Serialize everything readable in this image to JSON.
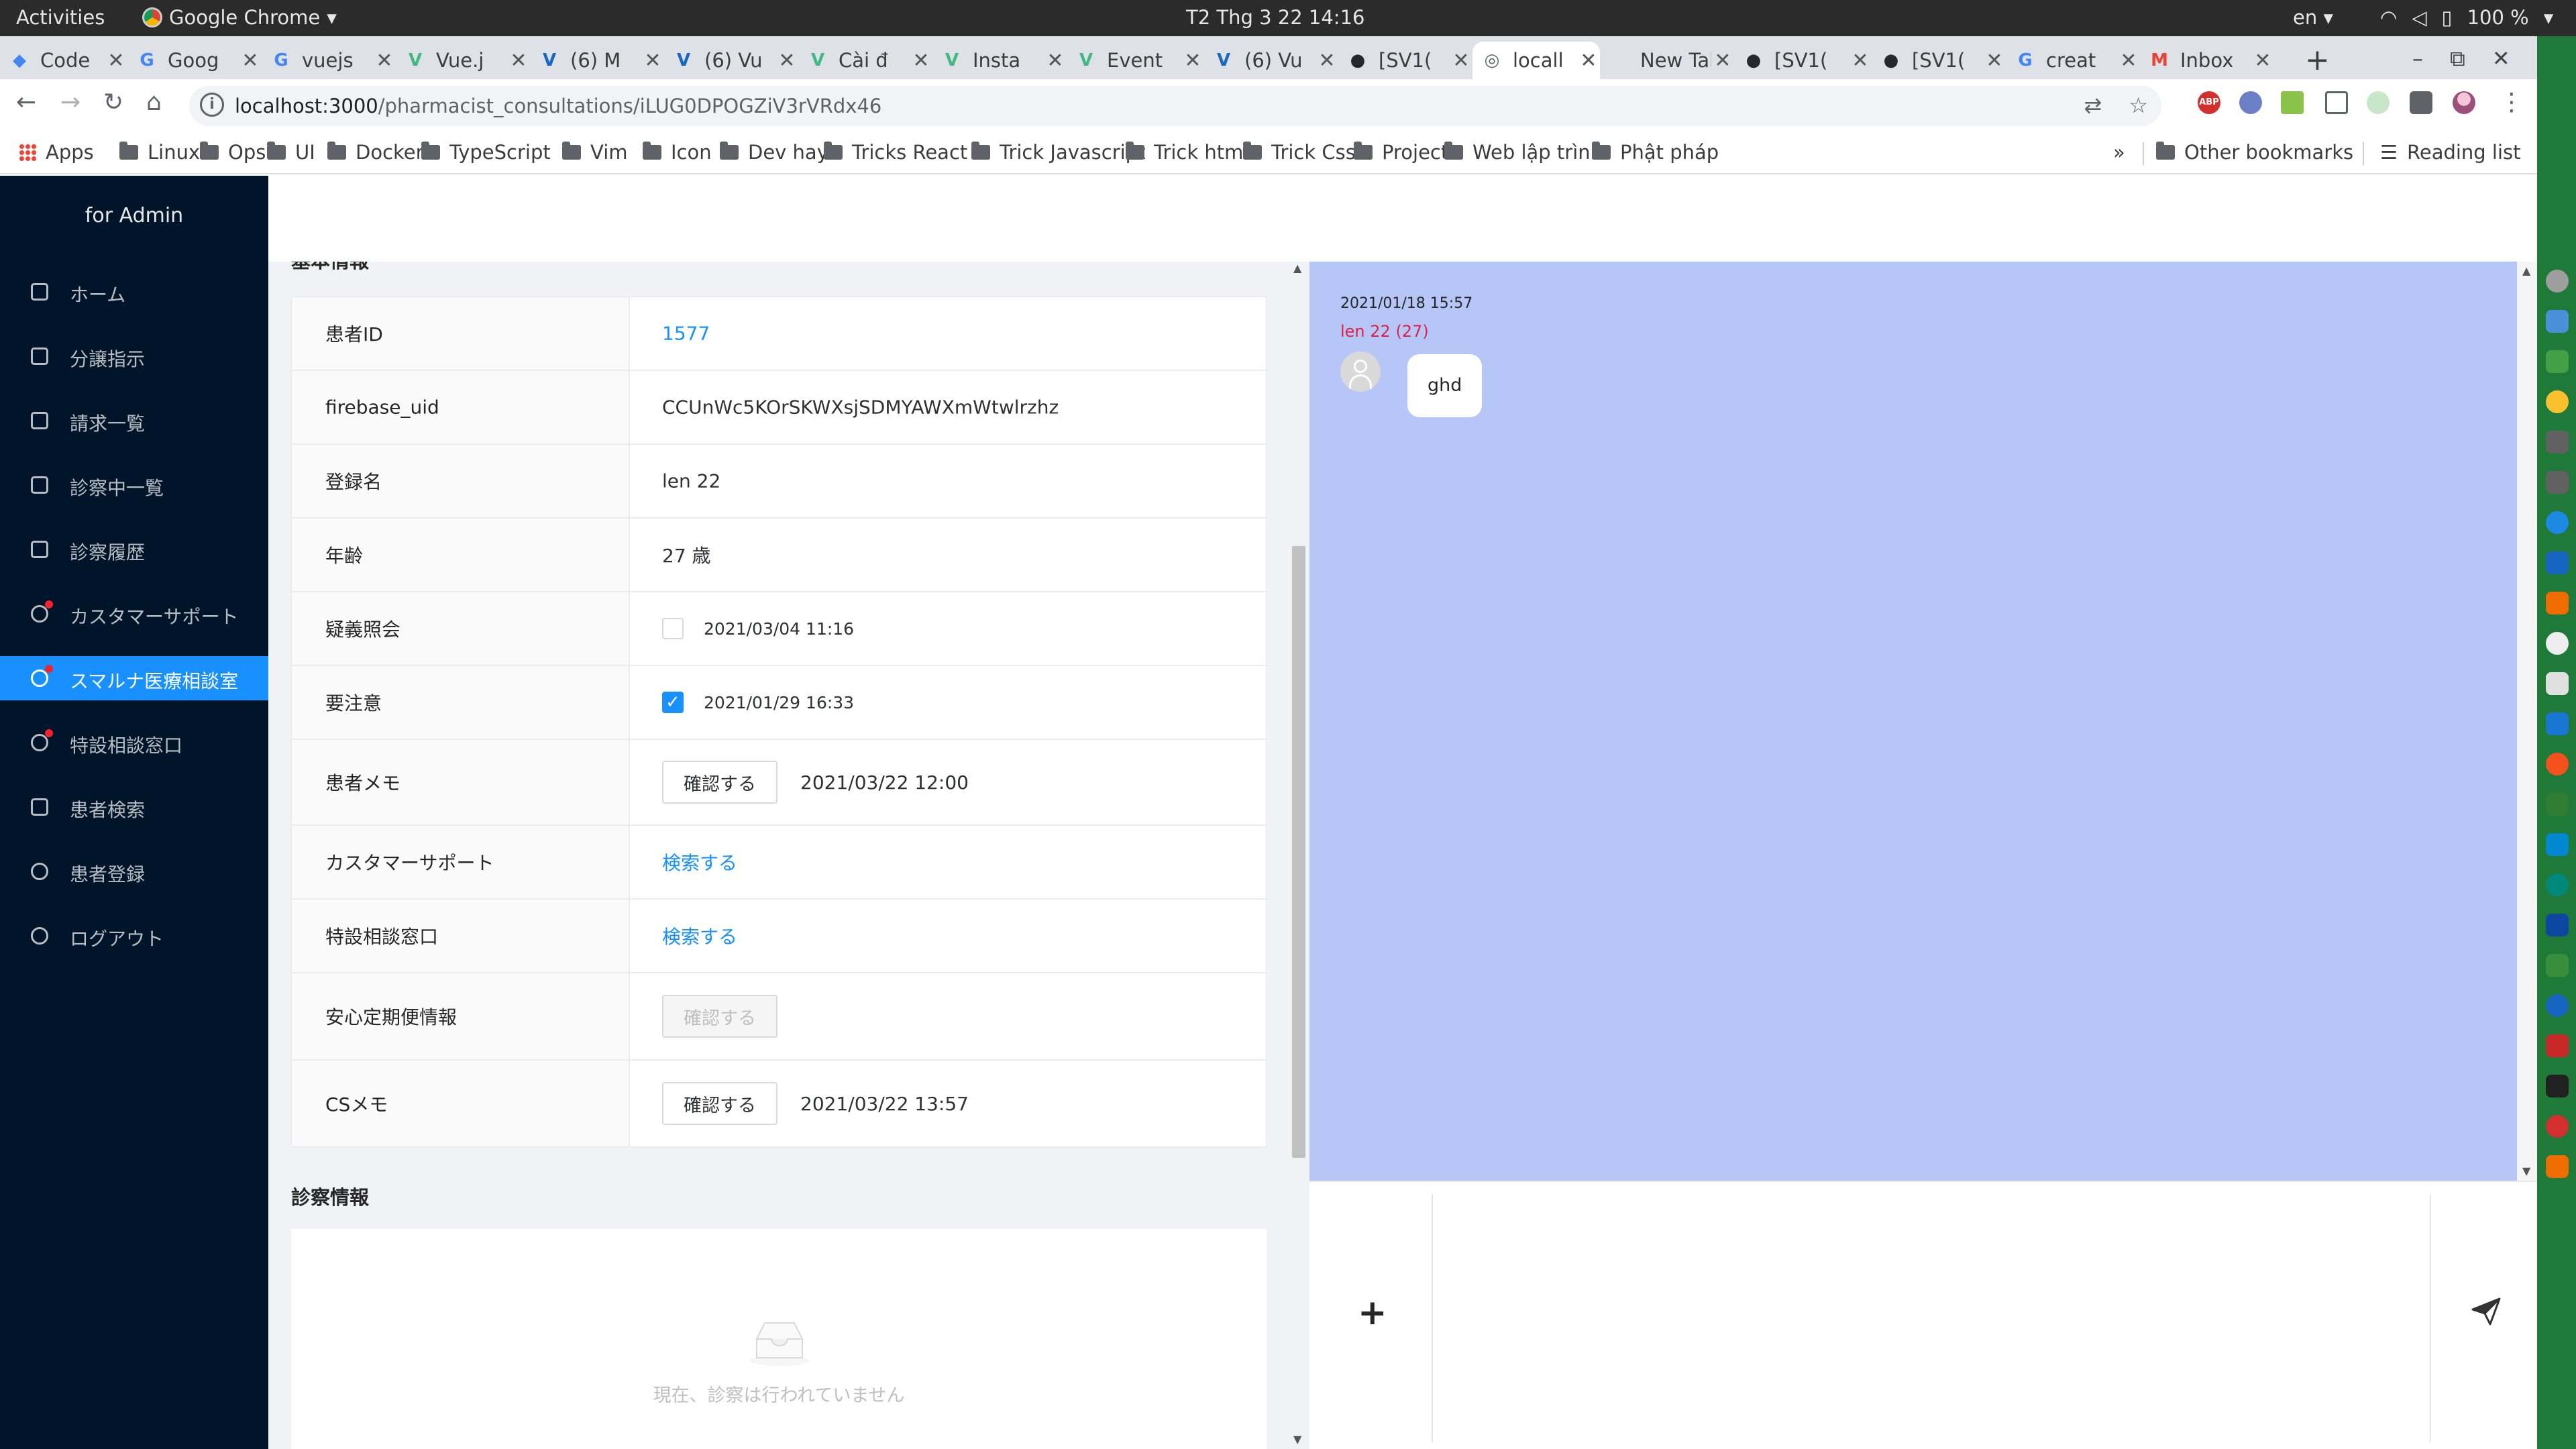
{
  "system_bar": {
    "activities": "Activities",
    "app_name": "Google Chrome",
    "clock": "T2 Thg 3 22  14:16",
    "language": "en",
    "battery": "100 %"
  },
  "browser": {
    "tabs": [
      {
        "label": "Code",
        "favicon": "code-icon",
        "color": "#4285f4"
      },
      {
        "label": "Goog",
        "favicon": "google-translate-icon",
        "color": "#4285f4"
      },
      {
        "label": "vuejs",
        "favicon": "google-icon",
        "color": "#4285f4"
      },
      {
        "label": "Vue.j",
        "favicon": "vue-icon",
        "color": "#42b883"
      },
      {
        "label": "(6) M",
        "favicon": "vuetify-icon",
        "color": "#1867c0"
      },
      {
        "label": "(6) Vu",
        "favicon": "vuetify-icon",
        "color": "#1867c0"
      },
      {
        "label": "Cài đ",
        "favicon": "vue-icon",
        "color": "#42b883"
      },
      {
        "label": "Insta",
        "favicon": "vue-icon",
        "color": "#42b883"
      },
      {
        "label": "Event",
        "favicon": "vue-icon",
        "color": "#42b883"
      },
      {
        "label": "(6) Vu",
        "favicon": "vuetify-icon",
        "color": "#1867c0"
      },
      {
        "label": "[SV1(",
        "favicon": "github-icon",
        "color": "#24292e"
      },
      {
        "label": "locall",
        "favicon": "globe-icon",
        "color": "#5f6368"
      },
      {
        "label": "New Tab",
        "favicon": "",
        "color": "#5f6368"
      },
      {
        "label": "[SV1(",
        "favicon": "github-icon",
        "color": "#24292e"
      },
      {
        "label": "[SV1(",
        "favicon": "github-icon",
        "color": "#24292e"
      },
      {
        "label": "creat",
        "favicon": "google-icon",
        "color": "#4285f4"
      },
      {
        "label": "Inbox",
        "favicon": "gmail-icon",
        "color": "#ea4335"
      }
    ],
    "active_tab": 11,
    "url_host": "localhost:3000",
    "url_path": "/pharmacist_consultations/iLUG0DPOGZiV3rVRdx46",
    "bookmarks": [
      "Apps",
      "Linux",
      "Ops",
      "UI",
      "Docker",
      "TypeScript",
      "Vim",
      "Icon",
      "Dev hay",
      "Tricks React",
      "Trick Javascript",
      "Trick html",
      "Trick Css",
      "Project",
      "Web lập trình",
      "Phật pháp"
    ],
    "bookmarks_overflow": "»",
    "other_bookmarks": "Other bookmarks",
    "reading_list": "Reading list"
  },
  "sidebar": {
    "brand": "for Admin",
    "items": [
      {
        "label": "ホーム",
        "icon": "home-icon",
        "badge": false
      },
      {
        "label": "分譲指示",
        "icon": "lock-icon",
        "badge": false
      },
      {
        "label": "請求一覧",
        "icon": "calendar-icon",
        "badge": false
      },
      {
        "label": "診察中一覧",
        "icon": "medicine-box-icon",
        "badge": false
      },
      {
        "label": "診察履歴",
        "icon": "file-search-icon",
        "badge": false
      },
      {
        "label": "カスタマーサポート",
        "icon": "chat-icon",
        "badge": true
      },
      {
        "label": "スマルナ医療相談室",
        "icon": "chat-icon",
        "badge": true
      },
      {
        "label": "特設相談窓口",
        "icon": "chat-icon",
        "badge": true
      },
      {
        "label": "患者検索",
        "icon": "file-search-icon",
        "badge": false
      },
      {
        "label": "患者登録",
        "icon": "user-icon",
        "badge": false
      },
      {
        "label": "ログアウト",
        "icon": "logout-icon",
        "badge": false
      }
    ],
    "active_index": 6
  },
  "basic_info": {
    "section_title": "基本情報",
    "rows": {
      "patient_id": {
        "label": "患者ID",
        "value": "1577"
      },
      "firebase_uid": {
        "label": "firebase_uid",
        "value": "CCUnWc5KOrSKWXsjSDMYAWXmWtwlrzhz"
      },
      "name": {
        "label": "登録名",
        "value": "len 22"
      },
      "age": {
        "label": "年齢",
        "value": "27 歳"
      },
      "inquiry": {
        "label": "疑義照会",
        "checked": false,
        "date": "2021/03/04 11:16"
      },
      "caution": {
        "label": "要注意",
        "checked": true,
        "date": "2021/01/29 16:33"
      },
      "patient_memo": {
        "label": "患者メモ",
        "button": "確認する",
        "date": "2021/03/22 12:00"
      },
      "customer_support": {
        "label": "カスタマーサポート",
        "link": "検索する"
      },
      "special_consult": {
        "label": "特設相談窓口",
        "link": "検索する"
      },
      "delivery_info": {
        "label": "安心定期便情報",
        "button": "確認する"
      },
      "cs_memo": {
        "label": "CSメモ",
        "button": "確認する",
        "date": "2021/03/22 13:57"
      }
    }
  },
  "exam_info": {
    "section_title": "診察情報",
    "empty_text": "現在、診察は行われていません"
  },
  "chat": {
    "messages": [
      {
        "time": "2021/01/18 15:57",
        "user": "len 22 (27)",
        "text": "ghd"
      }
    ],
    "input_placeholder": "",
    "colors": {
      "background": "#b5c6f7",
      "user_name": "#e0204a"
    }
  },
  "colors": {
    "sidebar_bg": "#001529",
    "accent": "#1890ff",
    "badge": "#f5222d"
  }
}
